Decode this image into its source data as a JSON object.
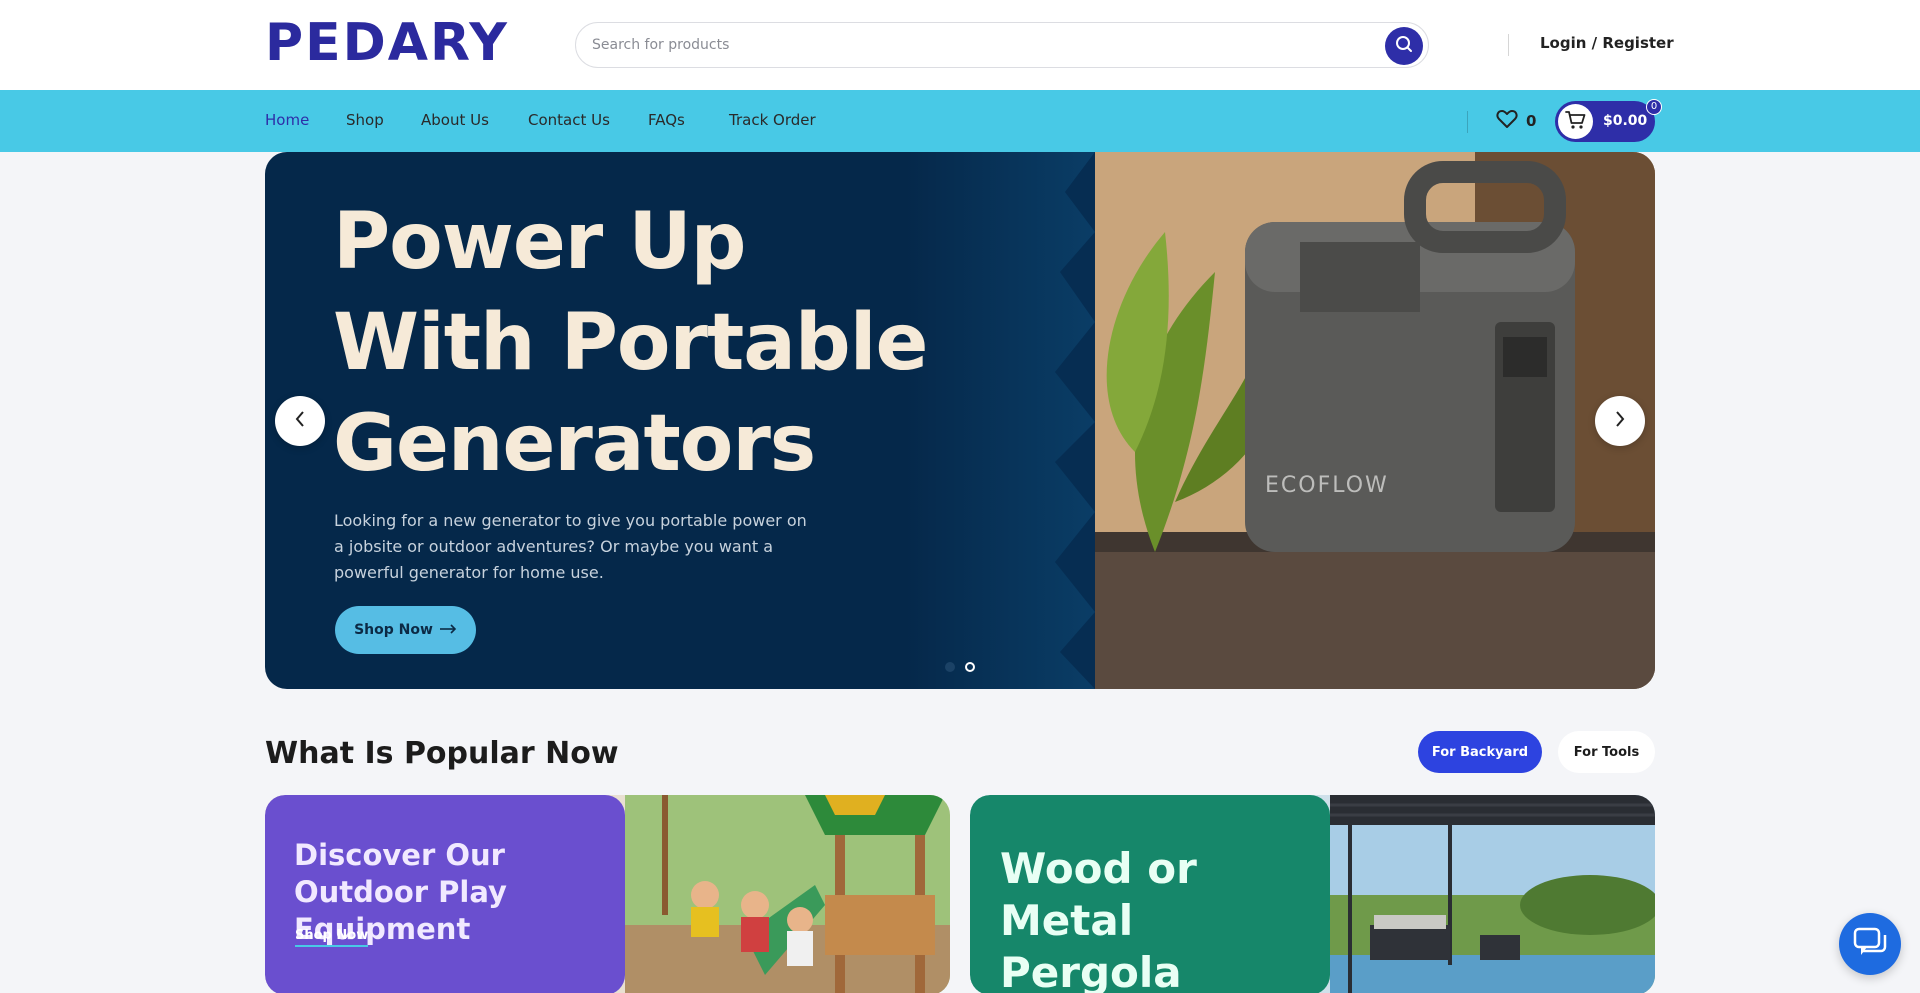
{
  "header": {
    "logo": "PEDARY",
    "search": {
      "placeholder": "Search for products",
      "value": ""
    },
    "login_label": "Login / Register"
  },
  "nav": {
    "items": [
      {
        "label": "Home",
        "active": true
      },
      {
        "label": "Shop",
        "active": false
      },
      {
        "label": "About Us",
        "active": false
      },
      {
        "label": "Contact Us",
        "active": false
      },
      {
        "label": "FAQs",
        "active": false
      },
      {
        "label": "Track Order",
        "active": false
      }
    ],
    "wishlist_count": "0",
    "cart_total": "$0.00",
    "cart_count": "0"
  },
  "hero": {
    "title": "Power Up With Portable Generators",
    "description": "Looking for a new generator to give you portable power on a jobsite or outdoor adventures? Or maybe you want a powerful generator for home use.",
    "cta_label": "Shop Now",
    "product_brand": "ECOFLOW",
    "slide_count": 2,
    "active_slide": 2
  },
  "popular": {
    "title": "What Is Popular Now",
    "tabs": [
      {
        "label": "For Backyard",
        "active": true
      },
      {
        "label": "For Tools",
        "active": false
      }
    ],
    "cards": [
      {
        "title": "Discover Our Outdoor Play Equipment",
        "link_label": "Shop Now"
      },
      {
        "title": "Wood or Metal Pergola"
      }
    ]
  },
  "colors": {
    "brand": "#2e2ea8",
    "nav_bg": "#48c9e6",
    "hero_bg": "#05284a",
    "tab_active": "#2d43e0",
    "card_purple": "#6a4fcf",
    "card_green": "#16876a"
  }
}
